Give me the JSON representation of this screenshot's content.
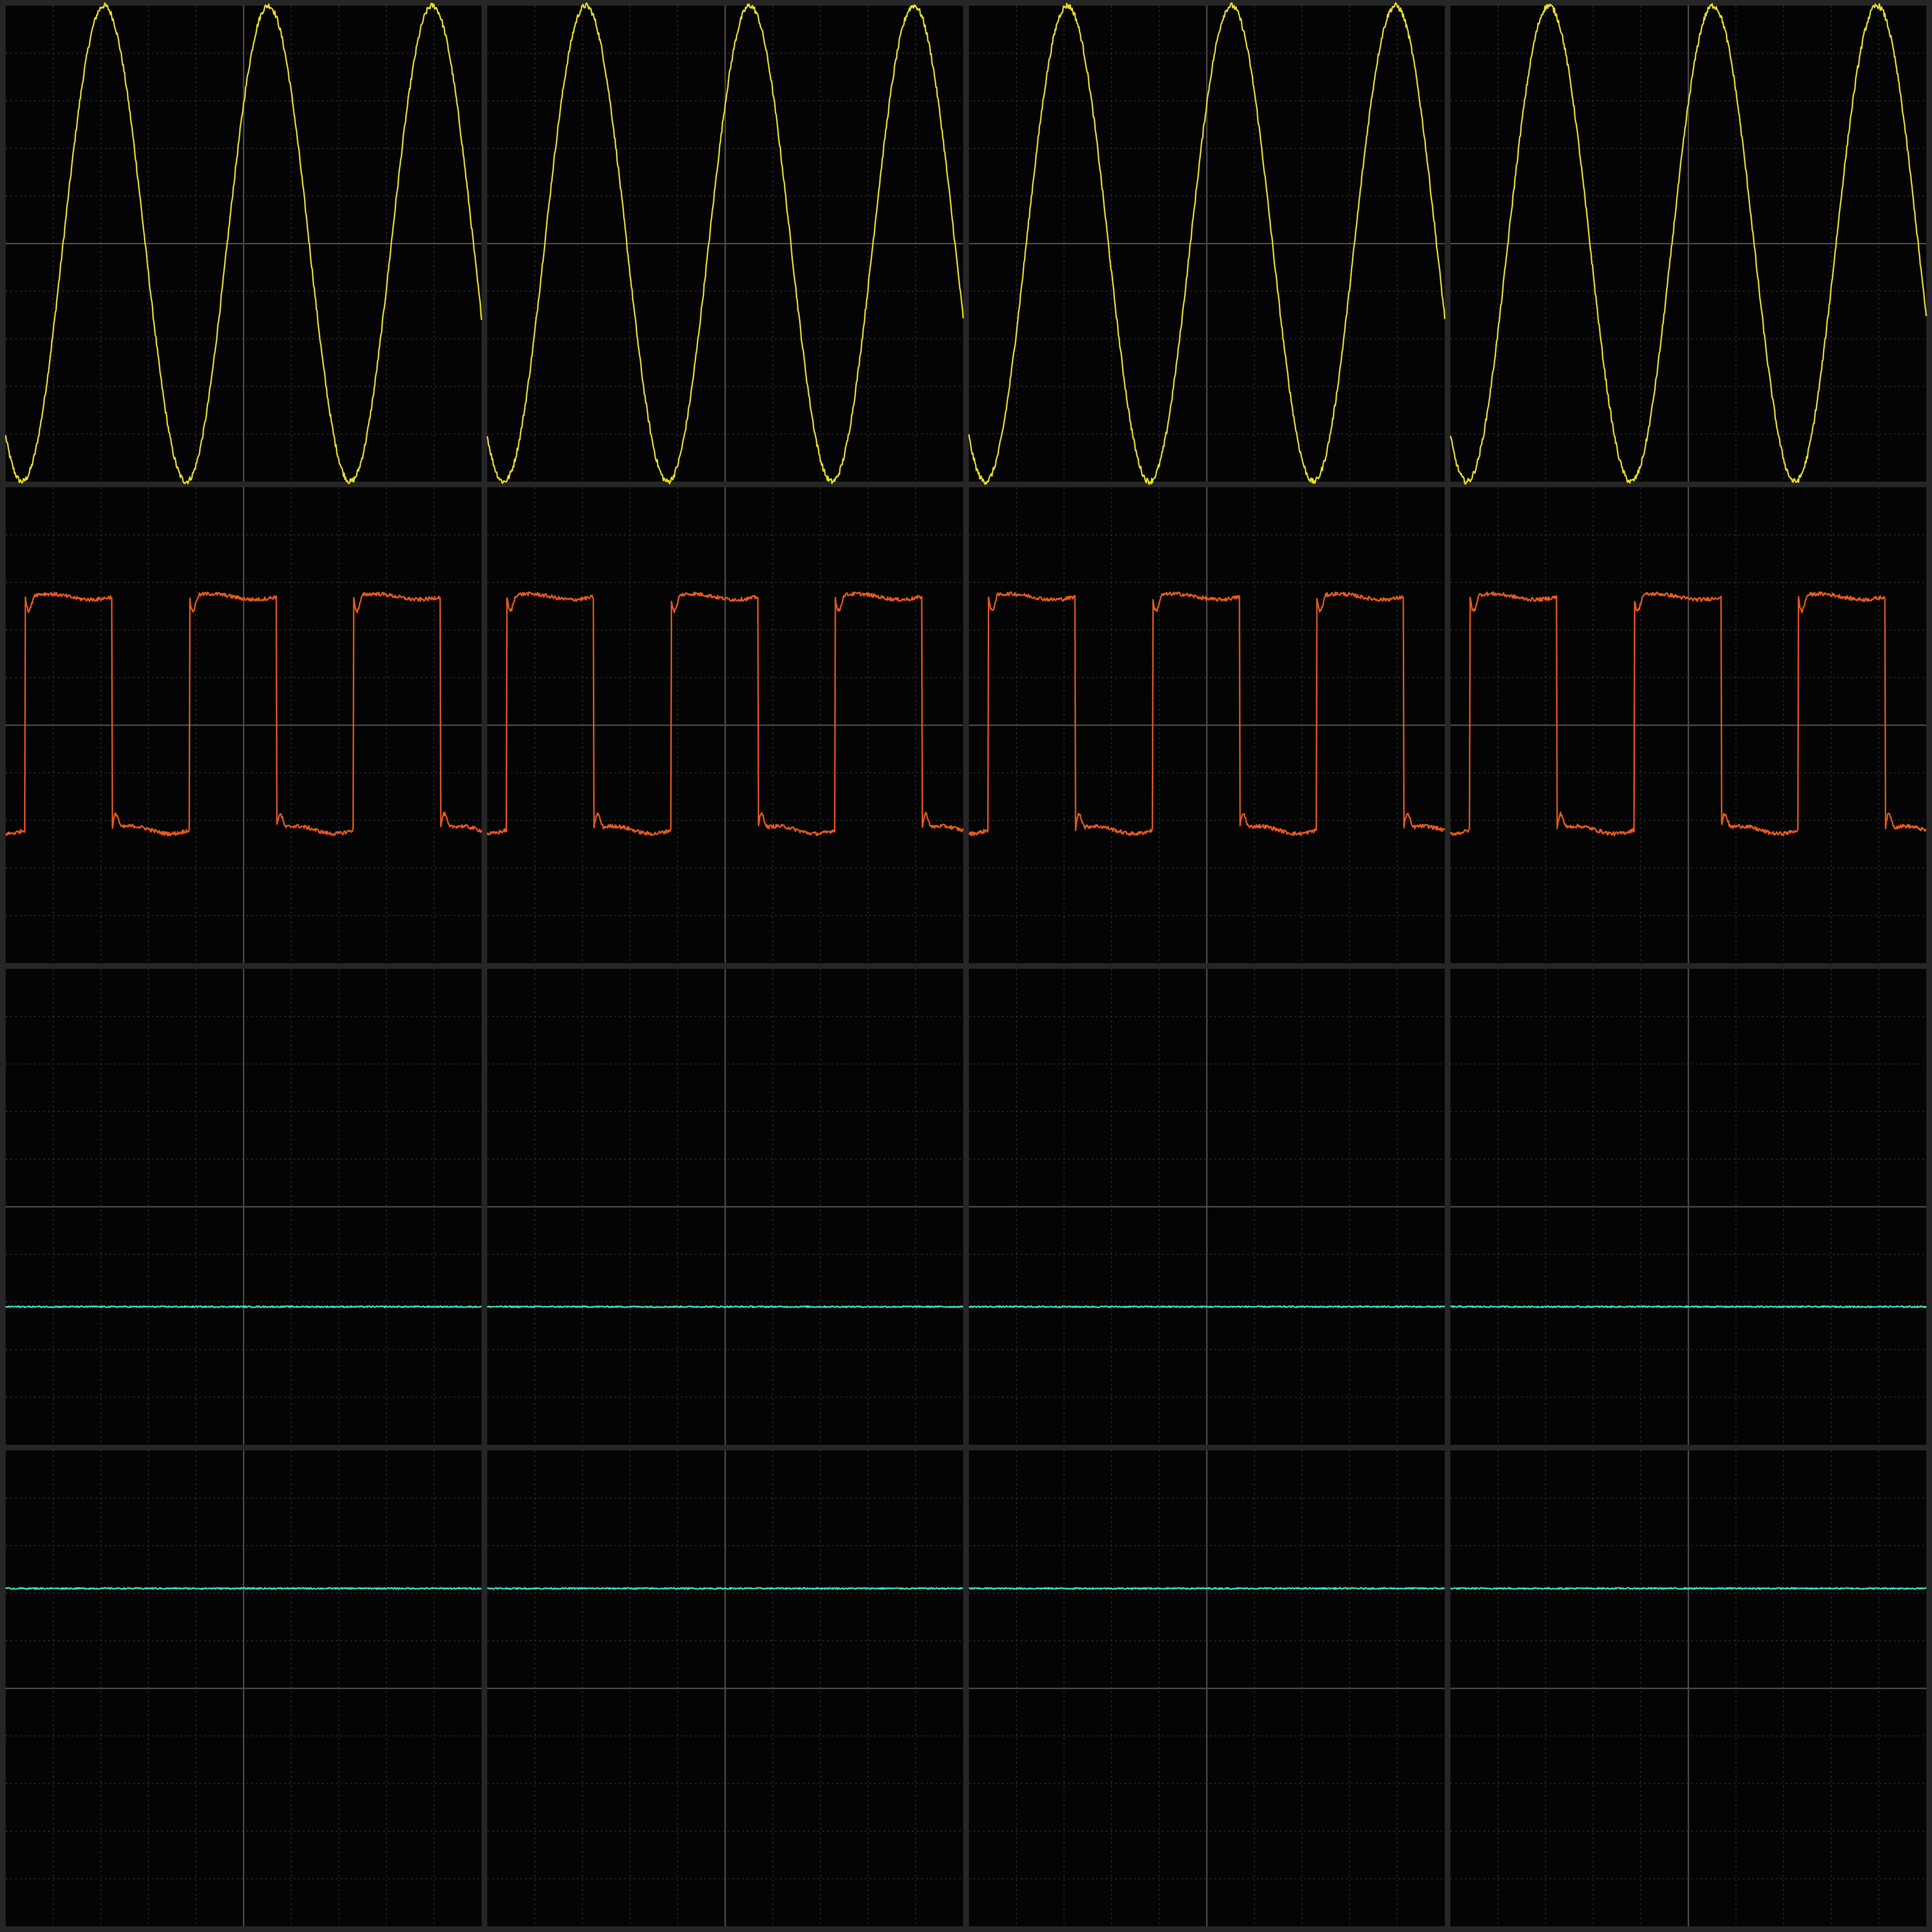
{
  "display": {
    "rows": 4,
    "cols": 4,
    "background_color": "#262626",
    "panel_color": "#040404",
    "grid_major_color": "#3a3a3a",
    "grid_minor_color": "#2a2a2a",
    "centerline_color": "#4a4a4a",
    "major_divisions": 2,
    "minor_divisions": 10
  },
  "channels": [
    {
      "row": 0,
      "waveform": "sine",
      "color": "#e8df2a",
      "cycles_per_panel": 2.9,
      "phase_turns": 0.65,
      "offset_div": 0.0,
      "amplitude_div": 0.5,
      "noise": 0.006
    },
    {
      "row": 1,
      "waveform": "square",
      "color": "#ea5a1e",
      "cycles_per_panel": 2.9,
      "phase_turns": 0.88,
      "duty": 0.53,
      "high_div": 0.27,
      "low_div": -0.22,
      "overshoot": true,
      "noise": 0.004
    },
    {
      "row": 2,
      "waveform": "flat",
      "color": "#3ee0c4",
      "offset_div": -0.21,
      "noise": 0.0015
    },
    {
      "row": 3,
      "waveform": "flat",
      "color": "#3ee0c4",
      "offset_div": 0.21,
      "noise": 0.0015
    }
  ]
}
